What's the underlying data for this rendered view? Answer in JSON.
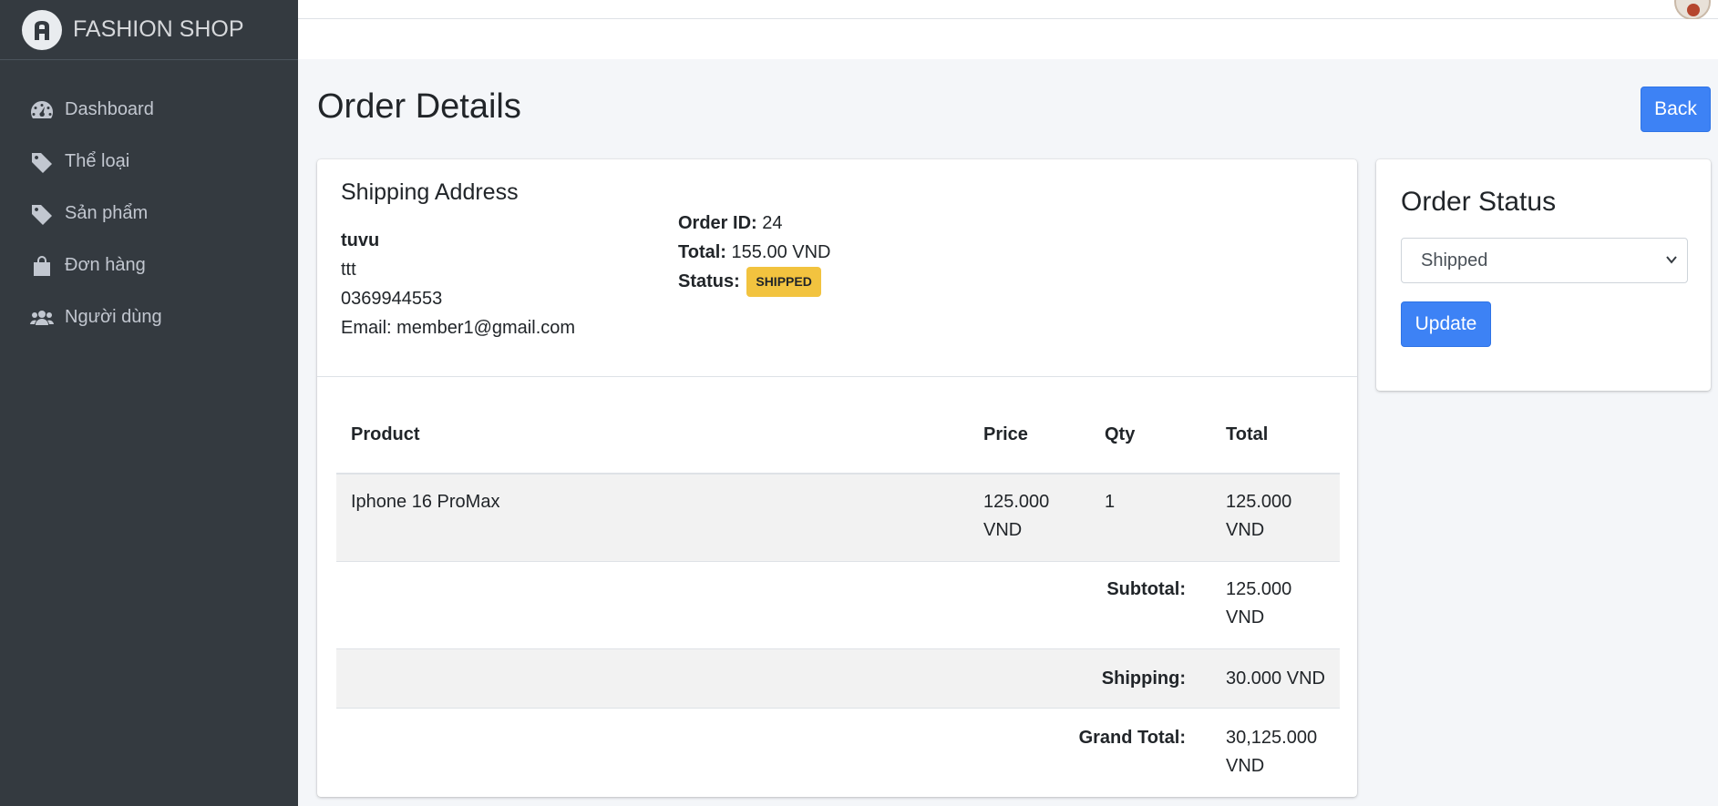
{
  "brand": {
    "name": "FASHION SHOP"
  },
  "sidebar": {
    "items": [
      {
        "label": "Dashboard",
        "icon": "dashboard-icon"
      },
      {
        "label": "Thể loại",
        "icon": "tag-icon"
      },
      {
        "label": "Sản phẩm",
        "icon": "tag-icon"
      },
      {
        "label": "Đơn hàng",
        "icon": "shopping-bag-icon"
      },
      {
        "label": "Người dùng",
        "icon": "users-icon"
      }
    ]
  },
  "page": {
    "title": "Order Details",
    "back_label": "Back"
  },
  "shipping": {
    "title": "Shipping Address",
    "name": "tuvu",
    "address": "ttt",
    "phone": "0369944553",
    "email": "Email: member1@gmail.com"
  },
  "order": {
    "id_label": "Order ID:",
    "id": "24",
    "total_label": "Total:",
    "total": "155.00 VND",
    "status_label": "Status:",
    "status": "SHIPPED",
    "status_color": "#f2c33f"
  },
  "table": {
    "headers": [
      "Product",
      "Price",
      "Qty",
      "Total"
    ],
    "rows": [
      {
        "product": "Iphone 16 ProMax",
        "price": "125.000 VND",
        "qty": "1",
        "total": "125.000 VND"
      }
    ],
    "subtotal_label": "Subtotal:",
    "subtotal": "125.000 VND",
    "shipping_label": "Shipping:",
    "shipping": "30.000 VND",
    "grand_total_label": "Grand Total:",
    "grand_total": "30,125.000 VND"
  },
  "status_panel": {
    "title": "Order Status",
    "selected": "Shipped",
    "update_label": "Update"
  },
  "colors": {
    "accent": "#3d82f5",
    "sidebar": "#343a40",
    "background": "#f4f6f9"
  }
}
